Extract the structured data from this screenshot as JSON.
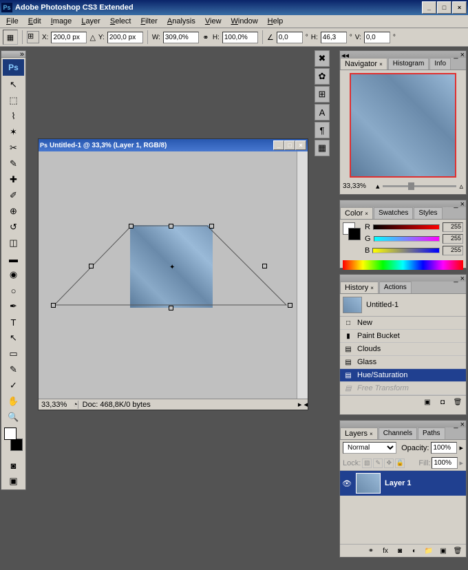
{
  "app": {
    "title": "Adobe Photoshop CS3 Extended",
    "icon": "Ps"
  },
  "menu": [
    "File",
    "Edit",
    "Image",
    "Layer",
    "Select",
    "Filter",
    "Analysis",
    "View",
    "Window",
    "Help"
  ],
  "options": {
    "x_label": "X:",
    "x": "200,0 px",
    "y_label": "Y:",
    "y": "200,0 px",
    "w_label": "W:",
    "w": "309,0%",
    "h_label": "H:",
    "h": "100,0%",
    "rot_label": "",
    "rot": "0,0",
    "sh_h_label": "H:",
    "sh_h": "46,3",
    "sh_v_label": "V:",
    "sh_v": "0,0",
    "deg": "°"
  },
  "doc": {
    "title": "Untitled-1 @ 33,3% (Layer 1, RGB/8)",
    "zoom": "33,33%",
    "info": "Doc: 468,8K/0 bytes"
  },
  "navigator": {
    "tabs": [
      "Navigator",
      "Histogram",
      "Info"
    ],
    "zoom": "33,33%"
  },
  "color": {
    "tabs": [
      "Color",
      "Swatches",
      "Styles"
    ],
    "r_label": "R",
    "g_label": "G",
    "b_label": "B",
    "r": "255",
    "g": "255",
    "b": "255"
  },
  "history": {
    "tabs": [
      "History",
      "Actions"
    ],
    "doc": "Untitled-1",
    "items": [
      {
        "label": "New",
        "icon": "□"
      },
      {
        "label": "Paint Bucket",
        "icon": "▮"
      },
      {
        "label": "Clouds",
        "icon": "▤"
      },
      {
        "label": "Glass",
        "icon": "▤"
      },
      {
        "label": "Hue/Saturation",
        "icon": "▤",
        "selected": true
      },
      {
        "label": "Free Transform",
        "icon": "▤",
        "dim": true
      }
    ]
  },
  "layers": {
    "tabs": [
      "Layers",
      "Channels",
      "Paths"
    ],
    "blend": "Normal",
    "opacity_label": "Opacity:",
    "opacity": "100%",
    "lock_label": "Lock:",
    "fill_label": "Fill:",
    "fill": "100%",
    "layer1": "Layer 1"
  }
}
